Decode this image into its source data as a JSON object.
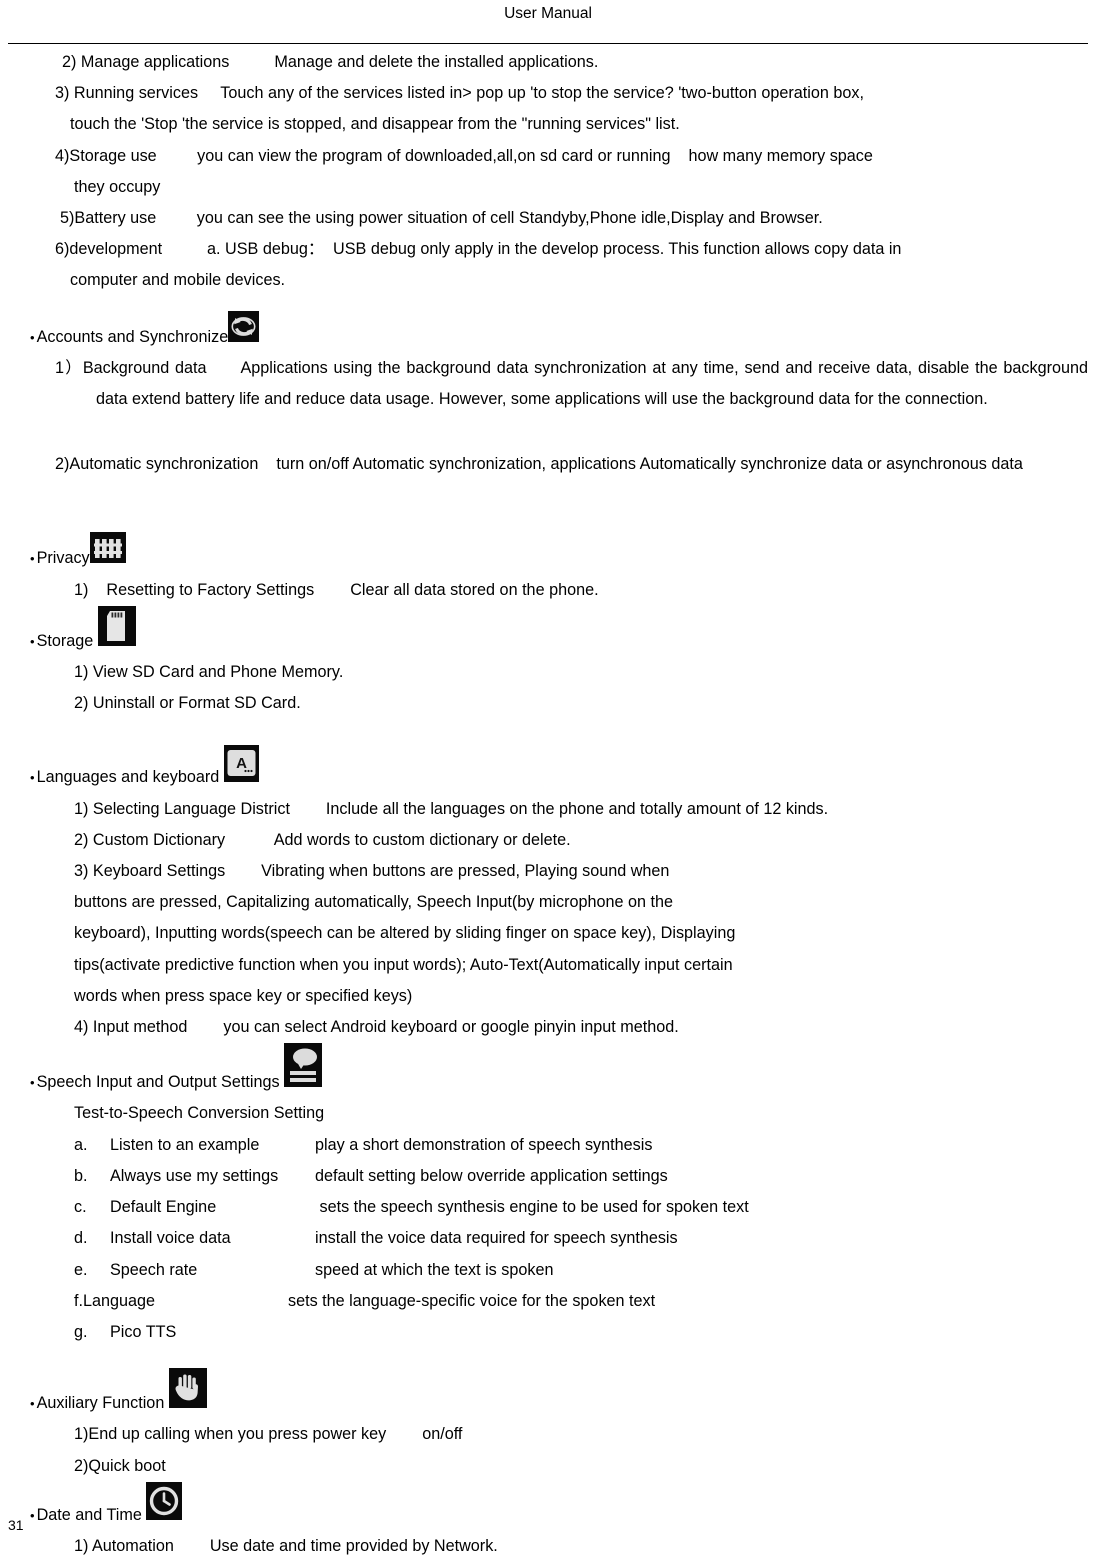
{
  "header": {
    "title": "User Manual"
  },
  "footer": {
    "page_number": "31"
  },
  "body": {
    "l1": "2) Manage applications          Manage and delete the installed applications.",
    "l2": "3) Running services     Touch any of the services listed in> pop up 'to stop the service? 'two-button operation box,",
    "l3": "touch the 'Stop 'the service is stopped, and disappear from the \"running services\" list.",
    "l4": "4)Storage use         you can view the program of downloaded,all,on sd card or running    how many memory space",
    "l5": "they occupy",
    "l6": "5)Battery use         you can see the using power situation of cell Standyby,Phone idle,Display and Browser.",
    "l7": "6)development          a. USB debug：  USB debug only apply in the develop process. This function allows copy data in",
    "l8": "computer and mobile devices."
  },
  "sections": {
    "accounts": {
      "bullet": "•",
      "label": "Accounts and Synchronize",
      "icon": "sync-icon",
      "item1_number": "1）",
      "item1_text": "Background data      Applications using the background data synchronization at any time, send and receive data, disable the background data extend battery life and reduce data usage. However, some applications will use the background data for the connection.",
      "item2_text": "2)Automatic synchronization    turn on/off Automatic synchronization, applications Automatically synchronize data or asynchronous data"
    },
    "privacy": {
      "bullet": "•",
      "label": "Privacy",
      "icon": "fence-icon",
      "items": [
        "1)    Resetting to Factory Settings        Clear all data stored on the phone."
      ]
    },
    "storage": {
      "bullet": "•",
      "label": "Storage ",
      "icon": "sd-card-icon",
      "items": [
        "1) View SD Card and Phone Memory.",
        "2) Uninstall or Format SD Card."
      ]
    },
    "languages": {
      "bullet": "•",
      "label": "Languages and keyboard ",
      "icon": "keyboard-a-icon",
      "items": [
        "1) Selecting Language District        Include all the languages on the phone and totally amount of 12 kinds.",
        "2) Custom Dictionary           Add words to custom dictionary or delete.",
        "3) Keyboard Settings        Vibrating when buttons are pressed, Playing sound when",
        "buttons are pressed, Capitalizing automatically, Speech Input(by microphone on the",
        "keyboard), Inputting words(speech can be altered by sliding finger on space key), Displaying",
        "tips(activate predictive function when you input words); Auto-Text(Automatically input certain",
        "words when press space key or specified keys)",
        "4) Input method        you can select Android keyboard or google pinyin input method."
      ]
    },
    "speech": {
      "bullet": "•",
      "label": "Speech Input and Output Settings ",
      "icon": "speech-bubble-icon",
      "subtitle": "Test-to-Speech Conversion Setting",
      "items": [
        {
          "marker": "a.",
          "name": "Listen to an example",
          "desc": "play a short demonstration of speech synthesis"
        },
        {
          "marker": "b.",
          "name": "Always use my settings",
          "desc": "default setting below override application settings"
        },
        {
          "marker": "c.",
          "name": "Default Engine",
          "desc": " sets the speech synthesis engine to be used for spoken text"
        },
        {
          "marker": "d.",
          "name": "Install voice data",
          "desc": "install the voice data required for speech synthesis"
        },
        {
          "marker": "e.",
          "name": "Speech rate",
          "desc": "speed at which the text is spoken"
        },
        {
          "marker": "f.",
          "name": "Language",
          "desc": "sets the language-specific voice for the spoken text"
        },
        {
          "marker": "g.",
          "name": "Pico TTS",
          "desc": ""
        }
      ]
    },
    "auxiliary": {
      "bullet": "•",
      "label": "Auxiliary Function ",
      "icon": "hand-icon",
      "items": [
        "1)End up calling when you press power key        on/off",
        "2)Quick boot"
      ]
    },
    "datetime": {
      "bullet": "•",
      "label": "Date and Time ",
      "icon": "clock-icon",
      "items": [
        "1) Automation        Use date and time provided by Network."
      ]
    }
  },
  "colors": {
    "text": "#000000",
    "background": "#ffffff",
    "icon_dark": "#0a0a0a",
    "icon_light": "#d8d8d8"
  }
}
